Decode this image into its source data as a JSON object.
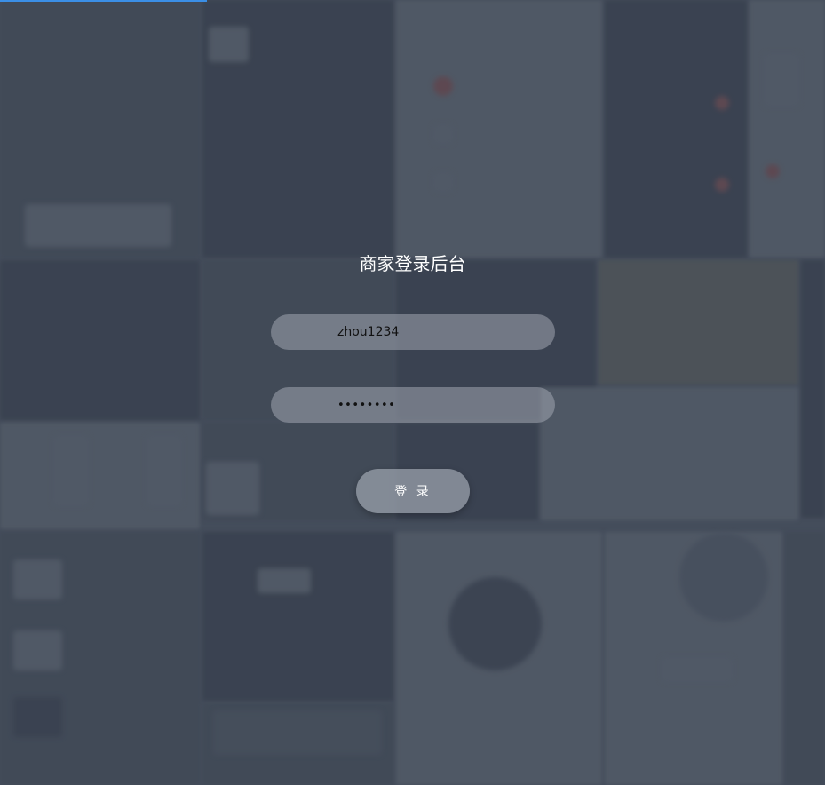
{
  "login": {
    "title": "商家登录后台",
    "username_value": "zhou1234",
    "password_value": "••••••••",
    "submit_label": "登 录"
  },
  "colors": {
    "background": "#4a5362",
    "accent": "#3b8fe6",
    "field_bg": "#8a909b",
    "text_light": "#ffffff"
  }
}
